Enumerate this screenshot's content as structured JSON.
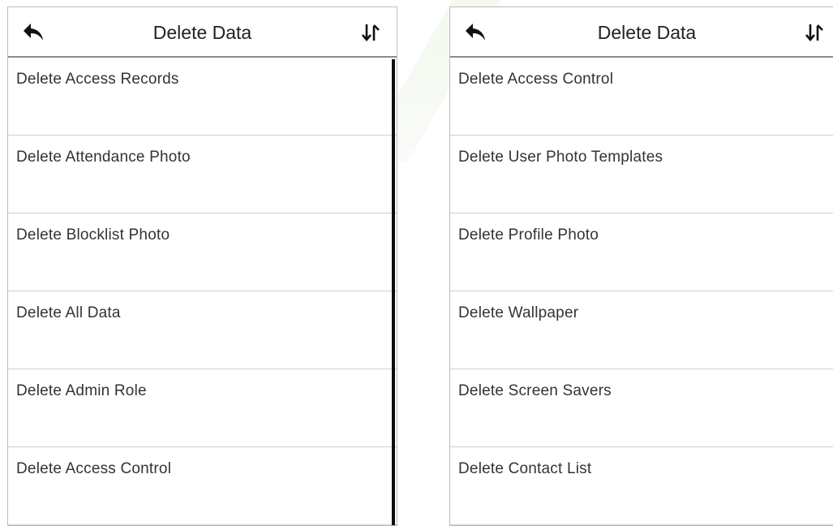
{
  "left_panel": {
    "title": "Delete Data",
    "items": [
      {
        "label": "Delete Access Records"
      },
      {
        "label": "Delete Attendance Photo"
      },
      {
        "label": "Delete Blocklist Photo"
      },
      {
        "label": "Delete All Data"
      },
      {
        "label": "Delete Admin Role"
      },
      {
        "label": "Delete Access Control"
      }
    ]
  },
  "right_panel": {
    "title": "Delete Data",
    "items": [
      {
        "label": "Delete Access Control"
      },
      {
        "label": "Delete User Photo Templates"
      },
      {
        "label": "Delete Profile Photo"
      },
      {
        "label": "Delete Wallpaper"
      },
      {
        "label": "Delete Screen Savers"
      },
      {
        "label": "Delete Contact List"
      }
    ]
  },
  "icons": {
    "back": "back-arrow-icon",
    "sort": "sort-arrows-icon"
  },
  "colors": {
    "text": "#333333",
    "divider": "#cfcfcf",
    "header_rule": "#8c8c8c",
    "scroll_thumb": "#0e0e0e"
  }
}
